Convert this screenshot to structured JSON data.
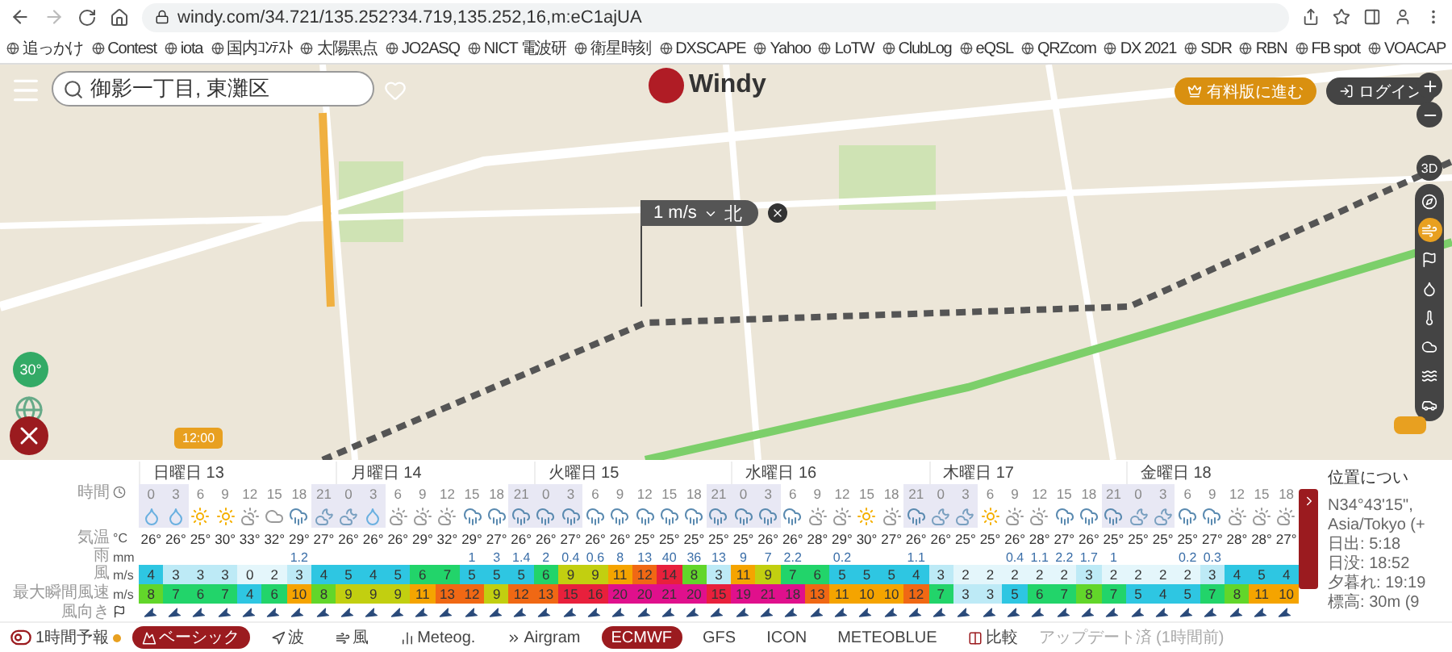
{
  "browser": {
    "url": "windy.com/34.721/135.252?34.719,135.252,16,m:eC1ajUA",
    "bookmarks": [
      "追っかけ",
      "Contest",
      "iota",
      "国内ｺﾝﾃｽﾄ",
      "太陽黒点",
      "JO2ASQ",
      "NICT 電波研",
      "衛星時刻",
      "DXSCAPE",
      "Yahoo",
      "LoTW",
      "ClubLog",
      "eQSL",
      "QRZcom",
      "DX 2021",
      "SDR",
      "RBN",
      "FB spot",
      "VOACAP"
    ]
  },
  "map": {
    "search": {
      "value": "御影一丁目, 東灘区"
    },
    "logo": "Windy",
    "premium_button": "有料版に進む",
    "login_button": "ログイン",
    "view_3d": "3D",
    "layers": [
      {
        "kind": "compass",
        "selected": false
      },
      {
        "kind": "wind",
        "selected": true
      },
      {
        "kind": "flag",
        "selected": false
      },
      {
        "kind": "rain",
        "selected": false
      },
      {
        "kind": "temp",
        "selected": false
      },
      {
        "kind": "cloud",
        "selected": false
      },
      {
        "kind": "waves",
        "selected": false
      },
      {
        "kind": "car",
        "selected": false
      }
    ],
    "picker": {
      "speed": "1 m/s",
      "direction": "北"
    },
    "temp_badge": "30°",
    "time_marker": "12:00"
  },
  "forecast": {
    "row_labels": [
      {
        "name": "時間"
      },
      {
        "name": "気温",
        "unit": "°C"
      },
      {
        "name": "雨",
        "unit": "mm"
      },
      {
        "name": "風",
        "unit": "m/s"
      },
      {
        "name": "最大瞬間風速",
        "unit": "m/s"
      },
      {
        "name": "風向き"
      }
    ],
    "days": [
      {
        "label": "日曜日 13",
        "hours": [
          {
            "h": "0",
            "night": true,
            "kind": "drop",
            "temp": "26°",
            "wind": "4",
            "gust": "8"
          },
          {
            "h": "3",
            "night": true,
            "kind": "drop",
            "temp": "26°",
            "wind": "3",
            "gust": "7"
          },
          {
            "h": "6",
            "night": false,
            "kind": "sun",
            "temp": "25°",
            "wind": "3",
            "gust": "6"
          },
          {
            "h": "9",
            "night": false,
            "kind": "sun",
            "temp": "30°",
            "wind": "3",
            "gust": "7"
          },
          {
            "h": "12",
            "night": false,
            "kind": "sun-cloud",
            "temp": "33°",
            "wind": "0",
            "gust": "4"
          },
          {
            "h": "15",
            "night": false,
            "kind": "cloud",
            "temp": "32°",
            "wind": "2",
            "gust": "6"
          },
          {
            "h": "18",
            "night": false,
            "kind": "rain",
            "temp": "29°",
            "rain": "1.2",
            "wind": "3",
            "gust": "10"
          },
          {
            "h": "21",
            "night": true,
            "kind": "moon-cloud",
            "temp": "27°",
            "wind": "4",
            "gust": "8"
          }
        ]
      },
      {
        "label": "月曜日 14",
        "hours": [
          {
            "h": "0",
            "night": true,
            "kind": "moon-cloud",
            "temp": "26°",
            "wind": "5",
            "gust": "9"
          },
          {
            "h": "3",
            "night": true,
            "kind": "drop",
            "temp": "26°",
            "wind": "4",
            "gust": "9"
          },
          {
            "h": "6",
            "night": false,
            "kind": "sun-cloud",
            "temp": "26°",
            "wind": "5",
            "gust": "9"
          },
          {
            "h": "9",
            "night": false,
            "kind": "sun-cloud",
            "temp": "29°",
            "wind": "6",
            "gust": "11"
          },
          {
            "h": "12",
            "night": false,
            "kind": "sun-cloud",
            "temp": "32°",
            "wind": "7",
            "gust": "13"
          },
          {
            "h": "15",
            "night": false,
            "kind": "rain",
            "temp": "29°",
            "rain": "1",
            "wind": "5",
            "gust": "12"
          },
          {
            "h": "18",
            "night": false,
            "kind": "rain",
            "temp": "27°",
            "rain": "3",
            "wind": "5",
            "gust": "9"
          },
          {
            "h": "21",
            "night": true,
            "kind": "rain",
            "temp": "26°",
            "rain": "1.4",
            "wind": "5",
            "gust": "12"
          }
        ]
      },
      {
        "label": "火曜日 15",
        "hours": [
          {
            "h": "0",
            "night": true,
            "kind": "rain",
            "temp": "26°",
            "rain": "2",
            "wind": "6",
            "gust": "13"
          },
          {
            "h": "3",
            "night": true,
            "kind": "rain",
            "temp": "27°",
            "rain": "0.4",
            "wind": "9",
            "gust": "15"
          },
          {
            "h": "6",
            "night": false,
            "kind": "rain",
            "temp": "26°",
            "rain": "0.6",
            "wind": "9",
            "gust": "16"
          },
          {
            "h": "9",
            "night": false,
            "kind": "rain",
            "temp": "26°",
            "rain": "8",
            "wind": "11",
            "gust": "20"
          },
          {
            "h": "12",
            "night": false,
            "kind": "rain",
            "temp": "25°",
            "rain": "13",
            "wind": "12",
            "gust": "20"
          },
          {
            "h": "15",
            "night": false,
            "kind": "rain",
            "temp": "25°",
            "rain": "40",
            "wind": "14",
            "gust": "21"
          },
          {
            "h": "18",
            "night": false,
            "kind": "rain",
            "temp": "25°",
            "rain": "36",
            "wind": "8",
            "gust": "20"
          },
          {
            "h": "21",
            "night": true,
            "kind": "rain",
            "temp": "25°",
            "rain": "13",
            "wind": "3",
            "gust": "15"
          }
        ]
      },
      {
        "label": "水曜日 16",
        "hours": [
          {
            "h": "0",
            "night": true,
            "kind": "rain",
            "temp": "25°",
            "rain": "9",
            "wind": "11",
            "gust": "19"
          },
          {
            "h": "3",
            "night": true,
            "kind": "rain",
            "temp": "26°",
            "rain": "7",
            "wind": "9",
            "gust": "21"
          },
          {
            "h": "6",
            "night": false,
            "kind": "rain",
            "temp": "26°",
            "rain": "2.2",
            "wind": "7",
            "gust": "18"
          },
          {
            "h": "9",
            "night": false,
            "kind": "sun-cloud",
            "temp": "28°",
            "wind": "6",
            "gust": "13"
          },
          {
            "h": "12",
            "night": false,
            "kind": "sun-cloud",
            "temp": "29°",
            "rain": "0.2",
            "wind": "5",
            "gust": "11"
          },
          {
            "h": "15",
            "night": false,
            "kind": "sun",
            "temp": "30°",
            "wind": "5",
            "gust": "10"
          },
          {
            "h": "18",
            "night": false,
            "kind": "sun-cloud",
            "temp": "27°",
            "wind": "5",
            "gust": "10"
          },
          {
            "h": "21",
            "night": true,
            "kind": "rain",
            "temp": "26°",
            "rain": "1.1",
            "wind": "4",
            "gust": "12"
          }
        ]
      },
      {
        "label": "木曜日 17",
        "hours": [
          {
            "h": "0",
            "night": true,
            "kind": "moon-cloud",
            "temp": "26°",
            "wind": "3",
            "gust": "7"
          },
          {
            "h": "3",
            "night": true,
            "kind": "moon-cloud",
            "temp": "25°",
            "wind": "2",
            "gust": "3"
          },
          {
            "h": "6",
            "night": false,
            "kind": "sun",
            "temp": "25°",
            "wind": "2",
            "gust": "3"
          },
          {
            "h": "9",
            "night": false,
            "kind": "sun-cloud",
            "temp": "26°",
            "rain": "0.4",
            "wind": "2",
            "gust": "5"
          },
          {
            "h": "12",
            "night": false,
            "kind": "sun-cloud",
            "temp": "28°",
            "rain": "1.1",
            "wind": "2",
            "gust": "6"
          },
          {
            "h": "15",
            "night": false,
            "kind": "rain",
            "temp": "27°",
            "rain": "2.2",
            "wind": "2",
            "gust": "7"
          },
          {
            "h": "18",
            "night": false,
            "kind": "rain",
            "temp": "26°",
            "rain": "1.7",
            "wind": "3",
            "gust": "8"
          },
          {
            "h": "21",
            "night": true,
            "kind": "rain",
            "temp": "25°",
            "rain": "1",
            "wind": "2",
            "gust": "7"
          }
        ]
      },
      {
        "label": "金曜日 18",
        "hours": [
          {
            "h": "0",
            "night": true,
            "kind": "moon-cloud",
            "temp": "25°",
            "wind": "2",
            "gust": "5"
          },
          {
            "h": "3",
            "night": true,
            "kind": "moon-cloud",
            "temp": "25°",
            "wind": "2",
            "gust": "4"
          },
          {
            "h": "6",
            "night": false,
            "kind": "rain",
            "temp": "25°",
            "rain": "0.2",
            "wind": "2",
            "gust": "5"
          },
          {
            "h": "9",
            "night": false,
            "kind": "rain",
            "temp": "27°",
            "rain": "0.3",
            "wind": "3",
            "gust": "7"
          },
          {
            "h": "12",
            "night": false,
            "kind": "sun-cloud",
            "temp": "28°",
            "wind": "4",
            "gust": "8"
          },
          {
            "h": "15",
            "night": false,
            "kind": "sun-cloud",
            "temp": "28°",
            "wind": "5",
            "gust": "11"
          },
          {
            "h": "18",
            "night": false,
            "kind": "sun-cloud",
            "temp": "27°",
            "wind": "4",
            "gust": "10"
          }
        ]
      }
    ],
    "info": {
      "title": "位置につい",
      "lines": [
        "N34°43'15\",",
        "Asia/Tokyo (+",
        "日出: 5:18",
        "日没: 18:52",
        "夕暮れ: 19:19",
        "標高: 30m (9"
      ]
    },
    "toolbar": {
      "hourly": "1時間予報",
      "views": [
        {
          "label": "ベーシック",
          "selected": true
        },
        {
          "label": "波",
          "selected": false
        },
        {
          "label": "風",
          "selected": false
        },
        {
          "label": "Meteog.",
          "selected": false
        },
        {
          "label": "Airgram",
          "selected": false
        }
      ],
      "models": [
        {
          "label": "ECMWF",
          "selected": true
        },
        {
          "label": "GFS",
          "selected": false
        },
        {
          "label": "ICON",
          "selected": false
        },
        {
          "label": "METEOBLUE",
          "selected": false
        }
      ],
      "compare": "比較",
      "updated": "アップデート済 (1時間前)"
    }
  }
}
